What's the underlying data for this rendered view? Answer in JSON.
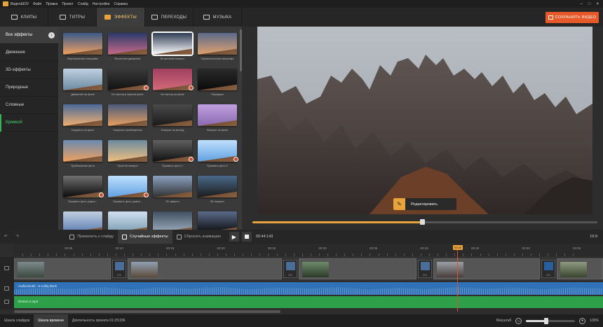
{
  "menubar": {
    "app": "ВидеоШОУ",
    "items": [
      "Файл",
      "Правка",
      "Проект",
      "Слайд",
      "Настройки",
      "Справка"
    ]
  },
  "tabs": [
    {
      "label": "КЛИПЫ",
      "icon": "clips-icon"
    },
    {
      "label": "ТИТРЫ",
      "icon": "titles-icon"
    },
    {
      "label": "ЭФФЕКТЫ",
      "icon": "effects-icon",
      "active": true
    },
    {
      "label": "ПЕРЕХОДЫ",
      "icon": "transitions-icon"
    },
    {
      "label": "МУЗЫКА",
      "icon": "music-icon"
    }
  ],
  "save_button": "СОХРАНИТЬ ВИДЕО",
  "categories": [
    "Все эффекты",
    "Движение",
    "3D-эффекты",
    "Природные",
    "Сложные",
    "Кромкой"
  ],
  "effects": [
    "Вертикальная панорама",
    "Встречное движение",
    "Встречный поворот",
    "Горизонтальная панорама",
    "Движение на фоне",
    "Из частиц в черном фоне",
    "Из частиц на фоне",
    "Передача",
    "Гиацинты на фоне",
    "Гиацинты приближение",
    "Поворот на взгляд",
    "Поворот на фоне",
    "Приближение фото",
    "Простой поворот",
    "Проявить фото 1",
    "Проявить фото 2",
    "Проявить фото рафте...",
    "Проявить фото рафте...",
    "3D зависть",
    "3D поворот",
    "",
    "",
    "",
    ""
  ],
  "edit_button": "Редактировать",
  "toolbar": {
    "apply_all": "Применить к слайду",
    "random": "Случайные эффекты",
    "reset": "Сбросить анимацию",
    "timecode": "00:44:143",
    "ratio": "16:9"
  },
  "ruler_ticks": [
    "00:05",
    "00:10",
    "00:15",
    "00:20",
    "00:25",
    "00:30",
    "00:35",
    "00:40",
    "00:45",
    "00:50",
    "00:55"
  ],
  "playhead": "00:45",
  "transitions": [
    "2.0",
    "2.0",
    "2.0",
    "2.0"
  ],
  "audio_tracks": [
    "Audioclouds - 5 Coldy Back",
    "Derevo 2.mp3"
  ],
  "status": {
    "slides": "Шкала слайдов",
    "time": "Шкала времени",
    "duration": "Длительность проекта 01:29:206",
    "zoom_label": "Масштаб",
    "zoom_value": "100%"
  }
}
